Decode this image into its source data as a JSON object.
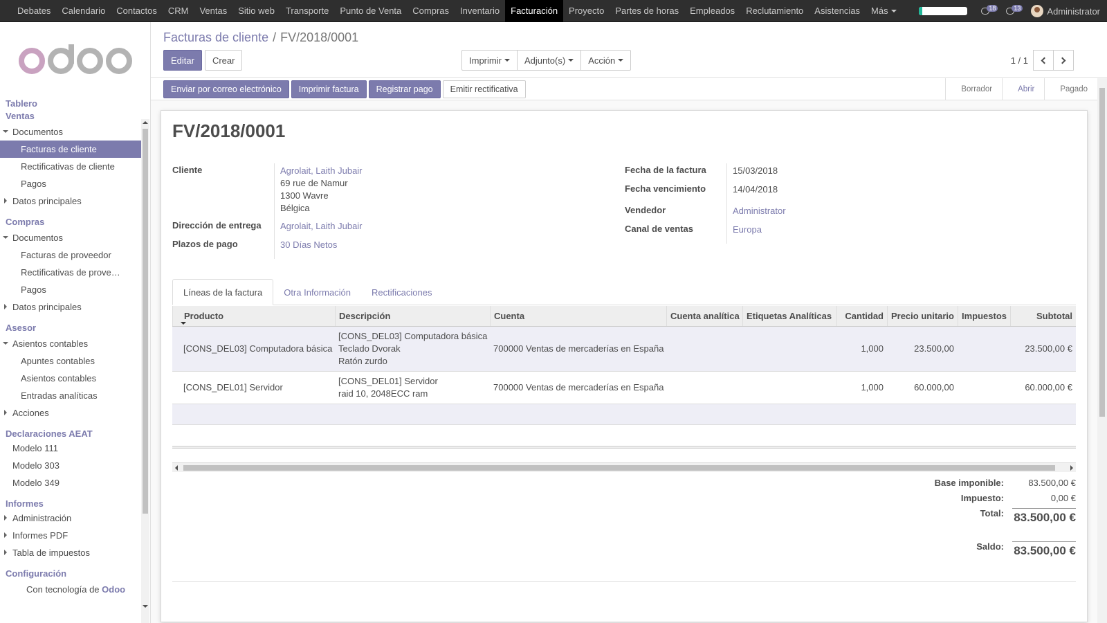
{
  "topbar": {
    "menus": [
      "Debates",
      "Calendario",
      "Contactos",
      "CRM",
      "Ventas",
      "Sitio web",
      "Transporte",
      "Punto de Venta",
      "Compras",
      "Inventario",
      "Facturación",
      "Proyecto",
      "Partes de horas",
      "Empleados",
      "Reclutamiento",
      "Asistencias",
      "Más"
    ],
    "active_menu": "Facturación",
    "progress": 0.07,
    "messages_count": "18",
    "activities_count": "13",
    "user_name": "Administrator"
  },
  "sidebar": {
    "powered_prefix": "Con tecnología de",
    "powered_brand": "Odoo",
    "sections": [
      {
        "title": "Tablero",
        "items": []
      },
      {
        "title": "Ventas",
        "items": [
          {
            "label": "Documentos",
            "type": "expanded"
          },
          {
            "label": "Facturas de cliente",
            "type": "sub",
            "active": true
          },
          {
            "label": "Rectificativas de cliente",
            "type": "sub"
          },
          {
            "label": "Pagos",
            "type": "sub"
          },
          {
            "label": "Datos principales",
            "type": "collapsed"
          }
        ]
      },
      {
        "title": "Compras",
        "items": [
          {
            "label": "Documentos",
            "type": "expanded"
          },
          {
            "label": "Facturas de proveedor",
            "type": "sub"
          },
          {
            "label": "Rectificativas de prove…",
            "type": "sub"
          },
          {
            "label": "Pagos",
            "type": "sub"
          },
          {
            "label": "Datos principales",
            "type": "collapsed"
          }
        ]
      },
      {
        "title": "Asesor",
        "items": [
          {
            "label": "Asientos contables",
            "type": "expanded"
          },
          {
            "label": "Apuntes contables",
            "type": "sub"
          },
          {
            "label": "Asientos contables",
            "type": "sub"
          },
          {
            "label": "Entradas analíticas",
            "type": "sub"
          },
          {
            "label": "Acciones",
            "type": "collapsed"
          }
        ]
      },
      {
        "title": "Declaraciones AEAT",
        "items": [
          {
            "label": "Modelo 111",
            "type": "plain"
          },
          {
            "label": "Modelo 303",
            "type": "plain"
          },
          {
            "label": "Modelo 349",
            "type": "plain"
          }
        ]
      },
      {
        "title": "Informes",
        "items": [
          {
            "label": "Administración",
            "type": "collapsed"
          },
          {
            "label": "Informes PDF",
            "type": "collapsed"
          },
          {
            "label": "Tabla de impuestos",
            "type": "collapsed"
          }
        ]
      },
      {
        "title": "Configuración",
        "items": []
      }
    ]
  },
  "control": {
    "breadcrumb_parent": "Facturas de cliente",
    "breadcrumb_current": "FV/2018/0001",
    "edit_label": "Editar",
    "create_label": "Crear",
    "print_label": "Imprimir",
    "attach_label": "Adjunto(s)",
    "action_label": "Acción",
    "pager_value": "1 / 1"
  },
  "statusbar": {
    "send_email": "Enviar por correo electrónico",
    "print_invoice": "Imprimir factura",
    "register_payment": "Registrar pago",
    "refund": "Emitir rectificativa",
    "states": [
      "Borrador",
      "Abrir",
      "Pagado"
    ],
    "current_state": "Abrir"
  },
  "invoice": {
    "number": "FV/2018/0001",
    "labels": {
      "customer": "Cliente",
      "delivery": "Dirección de entrega",
      "payment_terms": "Plazos de pago",
      "invoice_date": "Fecha de la factura",
      "due_date": "Fecha vencimiento",
      "salesperson": "Vendedor",
      "sales_channel": "Canal de ventas"
    },
    "customer_name": "Agrolait, Laith Jubair",
    "customer_street": "69 rue de Namur",
    "customer_city": "1300 Wavre",
    "customer_country": "Bélgica",
    "delivery_address": "Agrolait, Laith Jubair",
    "payment_terms": "30 Días Netos",
    "invoice_date": "15/03/2018",
    "due_date": "14/04/2018",
    "salesperson": "Administrator",
    "sales_channel": "Europa"
  },
  "tabs": [
    "Líneas de la factura",
    "Otra Información",
    "Rectificaciones"
  ],
  "lines": {
    "headers": [
      "Producto",
      "Descripción",
      "Cuenta",
      "Cuenta analítica",
      "Etiquetas Analíticas",
      "Cantidad",
      "Precio unitario",
      "Impuestos",
      "Subtotal"
    ],
    "rows": [
      {
        "product": "[CONS_DEL03] Computadora básica",
        "desc": [
          "[CONS_DEL03] Computadora básica",
          "Teclado Dvorak",
          "Ratón zurdo"
        ],
        "account": "700000 Ventas de mercaderías en España",
        "analytic": "",
        "tags": "",
        "qty": "1,000",
        "price": "23.500,00",
        "taxes": "",
        "subtotal": "23.500,00 €"
      },
      {
        "product": "[CONS_DEL01] Servidor",
        "desc": [
          "[CONS_DEL01] Servidor",
          "raid 10, 2048ECC ram"
        ],
        "account": "700000 Ventas de mercaderías en España",
        "analytic": "",
        "tags": "",
        "qty": "1,000",
        "price": "60.000,00",
        "taxes": "",
        "subtotal": "60.000,00 €"
      }
    ]
  },
  "totals": {
    "base_label": "Base imponible:",
    "base": "83.500,00 €",
    "tax_label": "Impuesto:",
    "tax": "0,00 €",
    "total_label": "Total:",
    "total": "83.500,00 €",
    "balance_label": "Saldo:",
    "balance": "83.500,00 €"
  },
  "colors": {
    "brand": "#7c7bad",
    "topbar": "#2f2f2f"
  }
}
